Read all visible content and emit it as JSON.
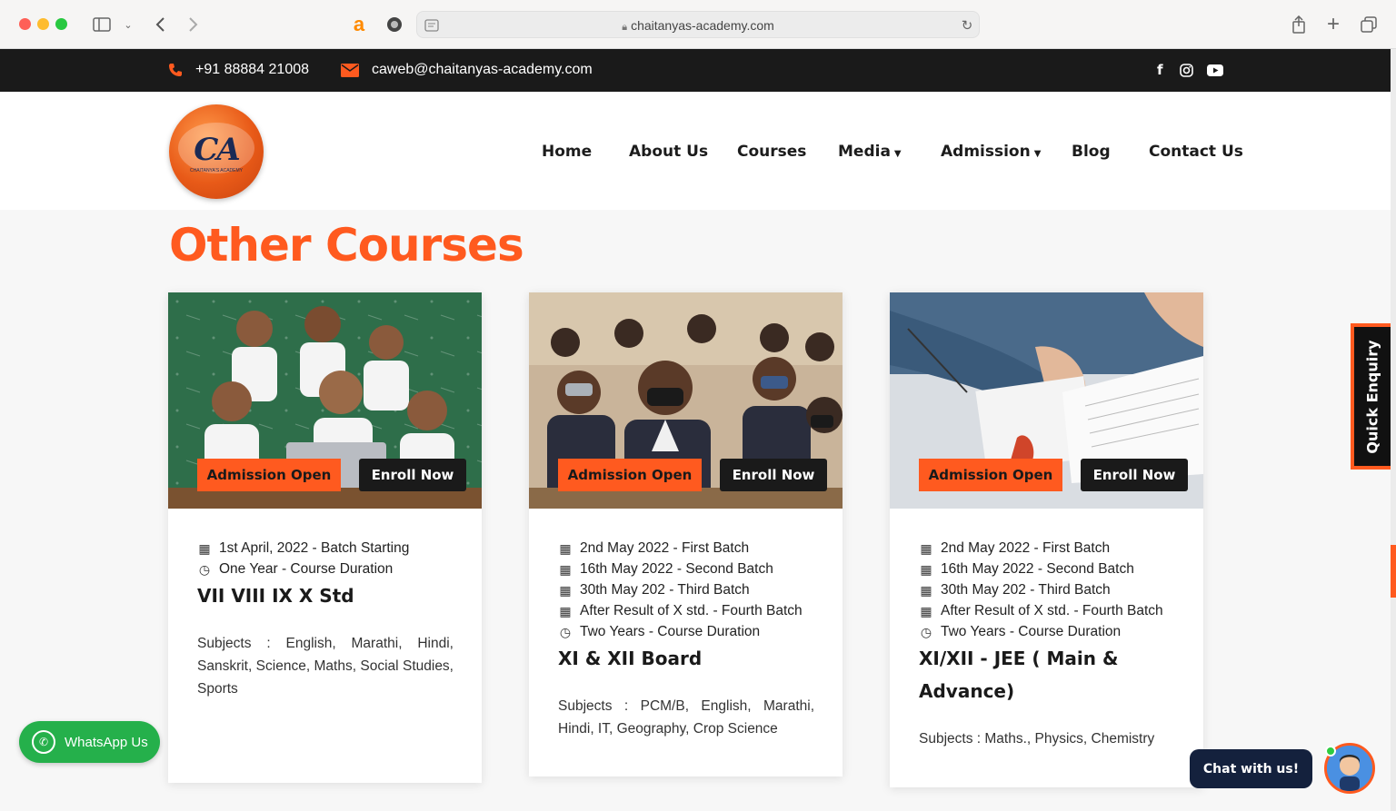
{
  "browser": {
    "url": "chaitanyas-academy.com"
  },
  "topbar": {
    "phone": "+91 88884 21008",
    "email": "caweb@chaitanyas-academy.com",
    "social_icons": [
      "facebook-icon",
      "instagram-icon",
      "youtube-icon"
    ]
  },
  "header": {
    "logo_text": "CA",
    "logo_subtext": "CHAITANYA'S ACADEMY",
    "nav": [
      {
        "label": "Home"
      },
      {
        "label": "About Us"
      },
      {
        "label": "Courses"
      },
      {
        "label": "Media"
      },
      {
        "label": "Admission"
      },
      {
        "label": "Blog"
      },
      {
        "label": "Contact Us"
      }
    ]
  },
  "main": {
    "section_title": "Other Courses",
    "cards": [
      {
        "admission_label": "Admission Open",
        "enroll_label": "Enroll Now",
        "batches": [
          "1st April, 2022 - Batch Starting"
        ],
        "duration": "One Year - Course Duration",
        "title": "VII VIII IX X Std",
        "subjects": "Subjects : English, Marathi, Hindi, Sanskrit, Science, Maths, Social Studies, Sports"
      },
      {
        "admission_label": "Admission Open",
        "enroll_label": "Enroll Now",
        "batches": [
          "2nd May 2022 - First Batch",
          "16th May 2022 - Second Batch",
          "30th May 202 - Third Batch",
          "After Result of X std. - Fourth Batch"
        ],
        "duration": "Two Years - Course Duration",
        "title": "XI & XII Board",
        "subjects": "Subjects : PCM/B, English, Marathi, Hindi, IT, Geography, Crop Science"
      },
      {
        "admission_label": "Admission Open",
        "enroll_label": "Enroll Now",
        "batches": [
          "2nd May 2022 - First Batch",
          "16th May 2022 - Second Batch",
          "30th May 202 - Third Batch",
          "After Result of X std. - Fourth Batch"
        ],
        "duration": "Two Years - Course Duration",
        "title": "XI/XII - JEE ( Main & Advance)",
        "subjects": "Subjects : Maths., Physics, Chemistry"
      }
    ]
  },
  "widgets": {
    "whatsapp_label": "WhatsApp Us",
    "quick_enquiry_label": "Quick Enquiry",
    "chat_label": "Chat with us!"
  },
  "colors": {
    "accent": "#ff5a1f",
    "dark": "#1a1a1a",
    "whatsapp": "#25b04b"
  }
}
